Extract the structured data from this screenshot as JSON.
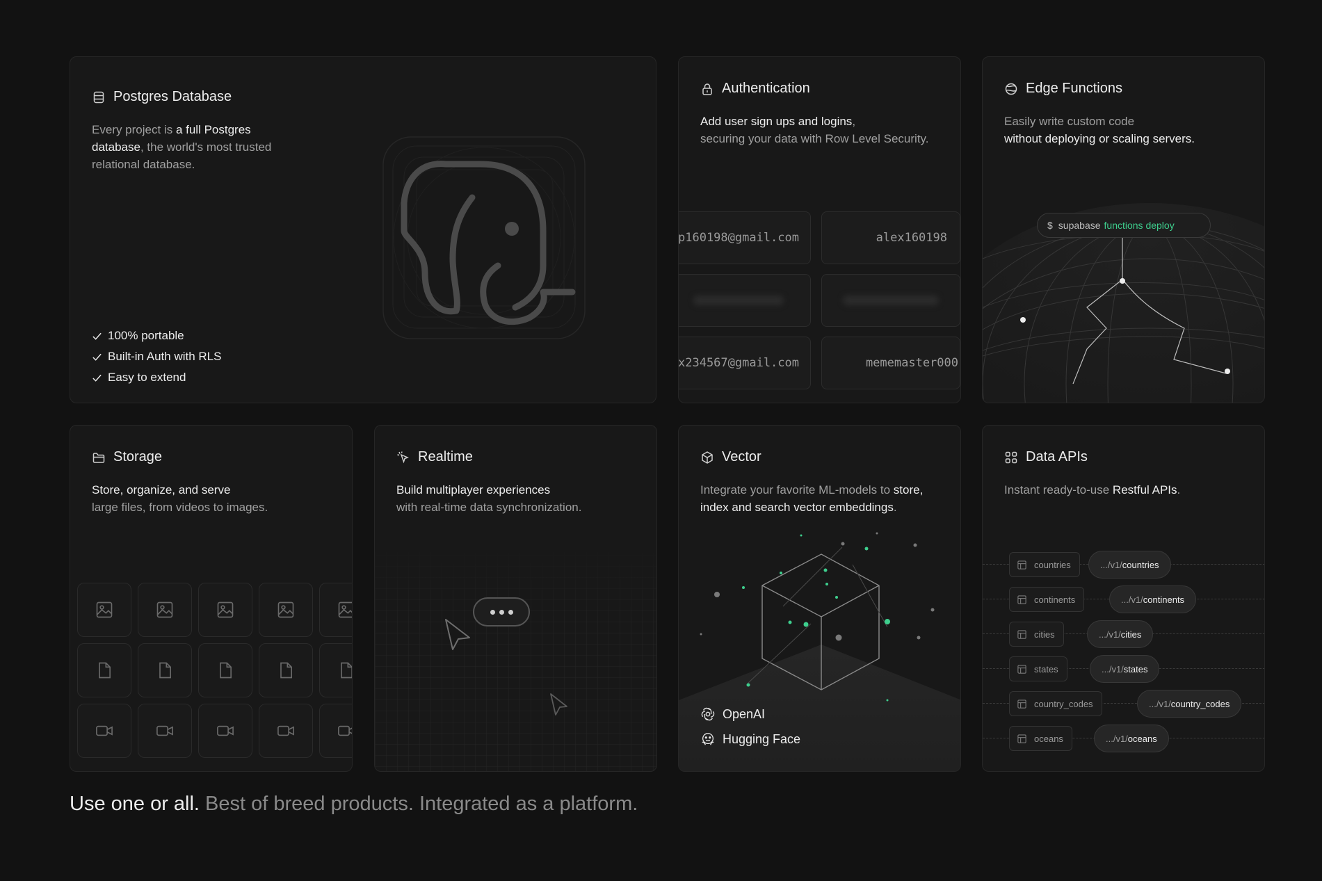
{
  "postgres": {
    "title": "Postgres Database",
    "desc_1": "Every project is ",
    "desc_hl": "a full Postgres database",
    "desc_2": ", the world's most trusted relational database.",
    "features": [
      "100% portable",
      "Built-in Auth with RLS",
      "Easy to extend"
    ]
  },
  "auth": {
    "title": "Authentication",
    "desc_hl": "Add user sign ups and logins",
    "desc_comma": ",",
    "desc_2": "securing your data with Row Level Security.",
    "cells": {
      "email_1": "p160198@gmail.com",
      "user_1": "alex160198",
      "email_2": "x234567@gmail.com",
      "user_2": "mememaster000"
    }
  },
  "edge": {
    "title": "Edge Functions",
    "desc_1": "Easily write custom code",
    "desc_hl": "without deploying or scaling servers.",
    "command_prompt": "$",
    "command_base": "supabase",
    "command_hl": "functions deploy"
  },
  "storage": {
    "title": "Storage",
    "desc_hl": "Store, organize, and serve",
    "desc_2": "large files, from videos to images."
  },
  "realtime": {
    "title": "Realtime",
    "desc_hl": "Build multiplayer experiences",
    "desc_2": "with real-time data synchronization."
  },
  "vector": {
    "title": "Vector",
    "desc_1": "Integrate your favorite ML-models to ",
    "desc_hl": "store, index and search vector embeddings",
    "desc_2": ".",
    "vendors": [
      "OpenAI",
      "Hugging Face"
    ]
  },
  "apis": {
    "title": "Data APIs",
    "desc_1": "Instant ready-to-use ",
    "desc_hl": "Restful APIs",
    "desc_2": ".",
    "endpoint_prefix": ".../v1/",
    "rows": [
      {
        "table": "countries",
        "endpoint": "countries"
      },
      {
        "table": "continents",
        "endpoint": "continents"
      },
      {
        "table": "cities",
        "endpoint": "cities"
      },
      {
        "table": "states",
        "endpoint": "states"
      },
      {
        "table": "country_codes",
        "endpoint": "country_codes"
      },
      {
        "table": "oceans",
        "endpoint": "oceans"
      }
    ]
  },
  "tagline": {
    "hl": "Use one or all.",
    "rest": " Best of breed products. Integrated as a platform."
  },
  "colors": {
    "background": "#121212",
    "card": "#181818",
    "border": "#262626",
    "accent_green": "#3ecf8e",
    "text_primary": "#ededed",
    "text_muted": "#a0a0a0"
  }
}
